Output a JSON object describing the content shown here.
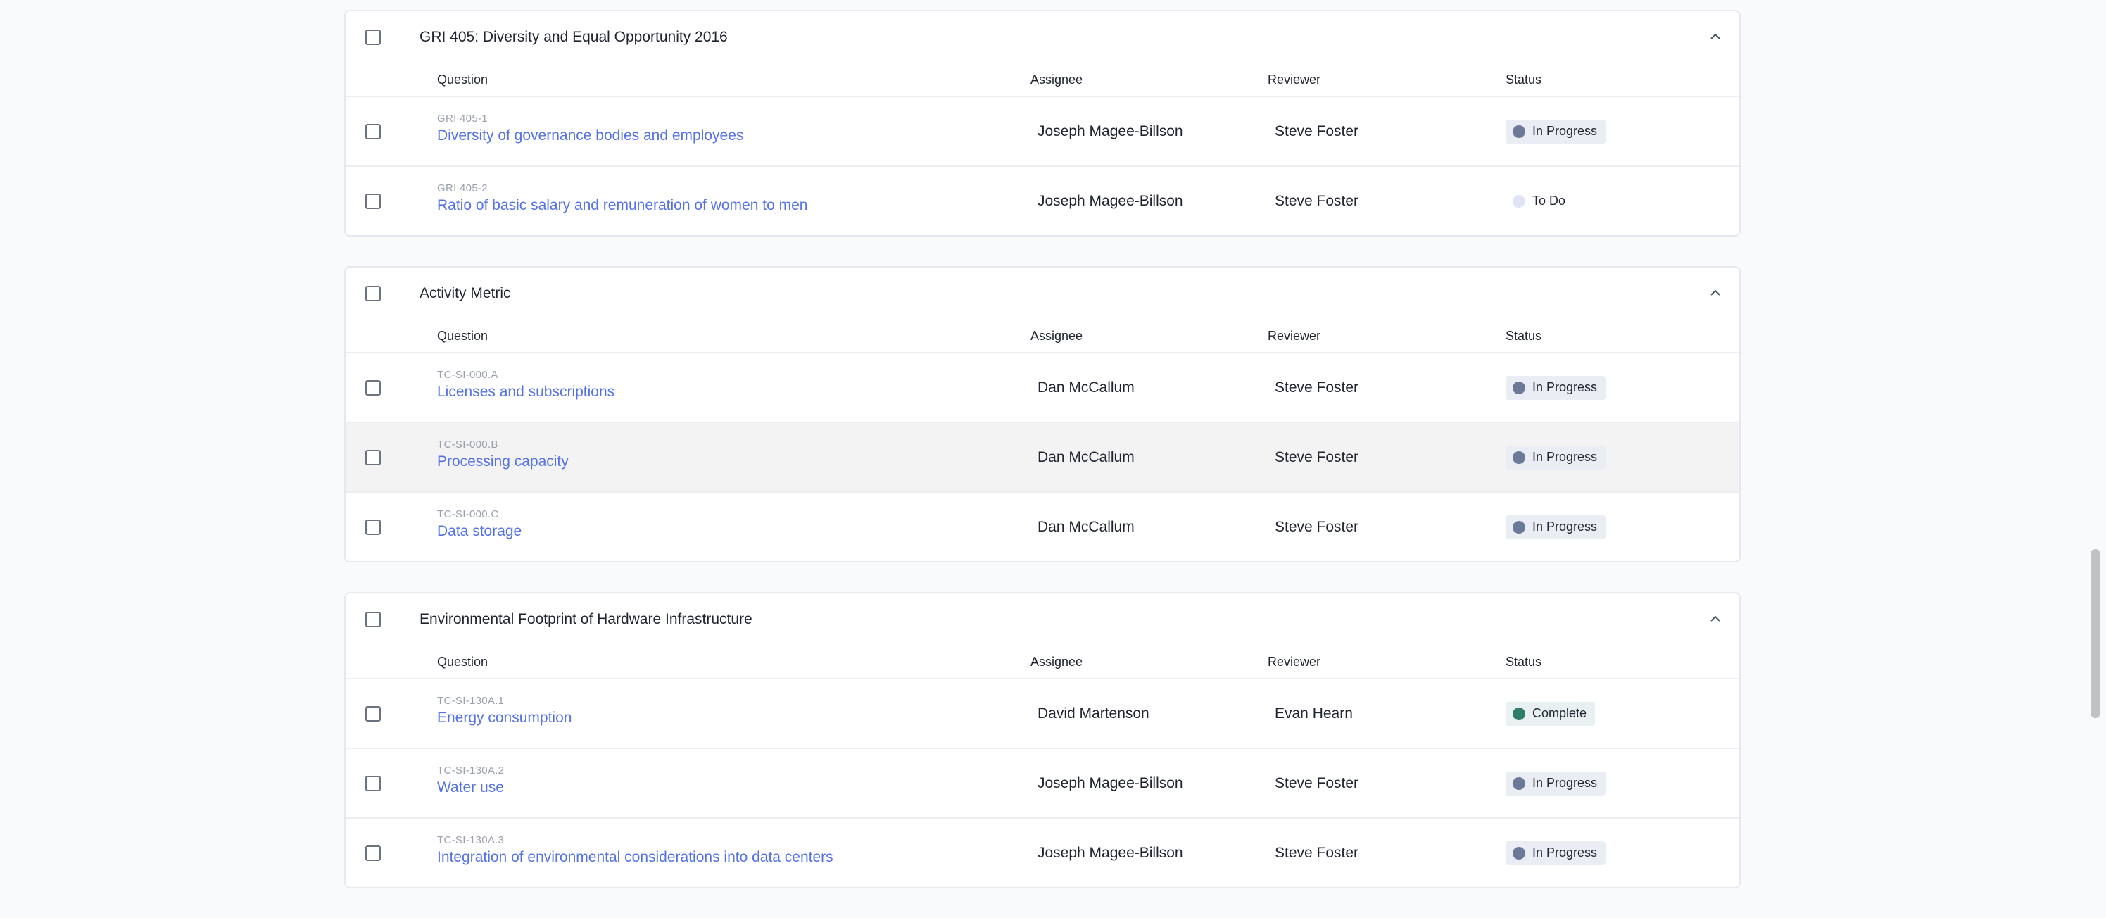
{
  "sections": [
    {
      "title": "GRI 405: Diversity and Equal Opportunity 2016",
      "headers": {
        "question": "Question",
        "assignee": "Assignee",
        "reviewer": "Reviewer",
        "status": "Status"
      },
      "rows": [
        {
          "code": "GRI 405-1",
          "question": "Diversity of governance bodies and employees",
          "assignee": "Joseph Magee-Billson",
          "reviewer": "Steve Foster",
          "status": "In Progress"
        },
        {
          "code": "GRI 405-2",
          "question": "Ratio of basic salary and remuneration of women to men",
          "assignee": "Joseph Magee-Billson",
          "reviewer": "Steve Foster",
          "status": "To Do"
        }
      ]
    },
    {
      "title": "Activity Metric",
      "headers": {
        "question": "Question",
        "assignee": "Assignee",
        "reviewer": "Reviewer",
        "status": "Status"
      },
      "rows": [
        {
          "code": "TC-SI-000.A",
          "question": "Licenses and subscriptions",
          "assignee": "Dan McCallum",
          "reviewer": "Steve Foster",
          "status": "In Progress"
        },
        {
          "code": "TC-SI-000.B",
          "question": "Processing capacity",
          "assignee": "Dan McCallum",
          "reviewer": "Steve Foster",
          "status": "In Progress"
        },
        {
          "code": "TC-SI-000.C",
          "question": "Data storage",
          "assignee": "Dan McCallum",
          "reviewer": "Steve Foster",
          "status": "In Progress"
        }
      ]
    },
    {
      "title": "Environmental Footprint of Hardware Infrastructure",
      "headers": {
        "question": "Question",
        "assignee": "Assignee",
        "reviewer": "Reviewer",
        "status": "Status"
      },
      "rows": [
        {
          "code": "TC-SI-130A.1",
          "question": "Energy consumption",
          "assignee": "David Martenson",
          "reviewer": "Evan Hearn",
          "status": "Complete"
        },
        {
          "code": "TC-SI-130A.2",
          "question": "Water use",
          "assignee": "Joseph Magee-Billson",
          "reviewer": "Steve Foster",
          "status": "In Progress"
        },
        {
          "code": "TC-SI-130A.3",
          "question": "Integration of environmental considerations into data centers",
          "assignee": "Joseph Magee-Billson",
          "reviewer": "Steve Foster",
          "status": "In Progress"
        }
      ]
    }
  ],
  "colors": {
    "link": "#5472e6",
    "in_progress_dot": "#6b7a99",
    "todo_dot": "#e1e4f5",
    "complete_dot": "#2e7d6b"
  }
}
